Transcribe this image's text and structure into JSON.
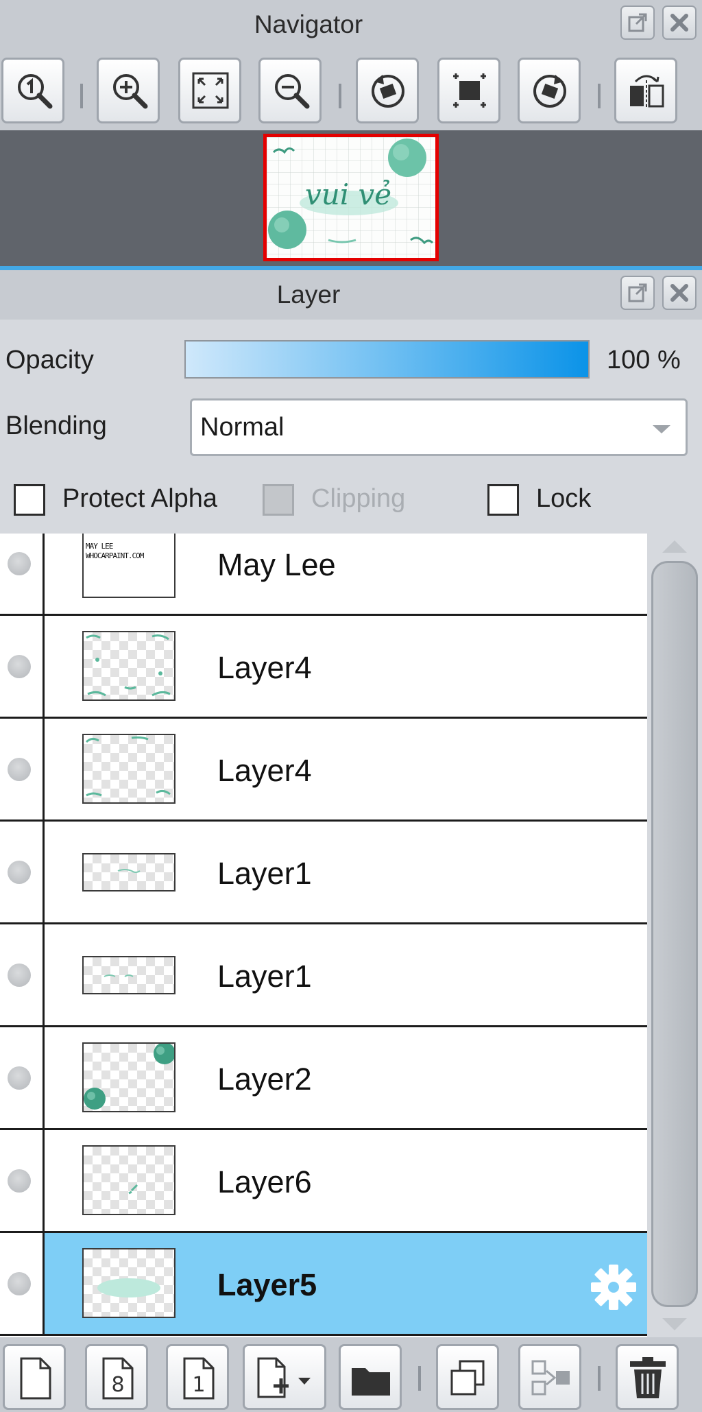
{
  "navigator": {
    "title": "Navigator",
    "toolbar": [
      {
        "name": "actual-size-button",
        "icon": "zoom-one-icon"
      },
      {
        "name": "zoom-in-button",
        "icon": "zoom-in-icon"
      },
      {
        "name": "fit-to-window-button",
        "icon": "fit-window-icon"
      },
      {
        "name": "zoom-out-button",
        "icon": "zoom-out-icon"
      },
      {
        "name": "rotate-left-button",
        "icon": "rotate-left-icon"
      },
      {
        "name": "reset-rotation-button",
        "icon": "reset-view-icon"
      },
      {
        "name": "rotate-right-button",
        "icon": "rotate-right-icon"
      },
      {
        "name": "flip-horizontal-button",
        "icon": "flip-icon"
      }
    ],
    "preview_text": "vui vẻ"
  },
  "layer_panel": {
    "title": "Layer",
    "opacity_label": "Opacity",
    "opacity_value": "100 %",
    "opacity_fraction": 1.0,
    "blending_label": "Blending",
    "blending_value": "Normal",
    "protect_alpha_label": "Protect Alpha",
    "clipping_label": "Clipping",
    "lock_label": "Lock",
    "protect_alpha_checked": false,
    "clipping_enabled": false,
    "lock_checked": false,
    "layers": [
      {
        "name": "May Lee",
        "thumb_text_1": "MAY LEE",
        "thumb_text_2": "WHOCARPAINT.COM",
        "selected": false
      },
      {
        "name": "Layer4",
        "selected": false
      },
      {
        "name": "Layer4",
        "selected": false
      },
      {
        "name": "Layer1",
        "selected": false
      },
      {
        "name": "Layer1",
        "selected": false
      },
      {
        "name": "Layer2",
        "selected": false
      },
      {
        "name": "Layer6",
        "selected": false
      },
      {
        "name": "Layer5",
        "selected": true
      }
    ],
    "bottom_toolbar": [
      {
        "name": "new-layer-button",
        "icon": "page-icon"
      },
      {
        "name": "new-8bit-layer-button",
        "icon": "page-8-icon",
        "glyph": "8"
      },
      {
        "name": "new-1bit-layer-button",
        "icon": "page-1-icon",
        "glyph": "1"
      },
      {
        "name": "add-layer-menu-button",
        "icon": "add-page-dropdown-icon"
      },
      {
        "name": "new-folder-button",
        "icon": "folder-icon"
      },
      {
        "name": "duplicate-layer-button",
        "icon": "duplicate-icon"
      },
      {
        "name": "merge-down-button",
        "icon": "merge-icon"
      },
      {
        "name": "delete-layer-button",
        "icon": "trash-icon"
      }
    ]
  },
  "colors": {
    "selection": "#7ecef6",
    "accent": "#0b93e8",
    "navigator_frame": "#e40000"
  }
}
